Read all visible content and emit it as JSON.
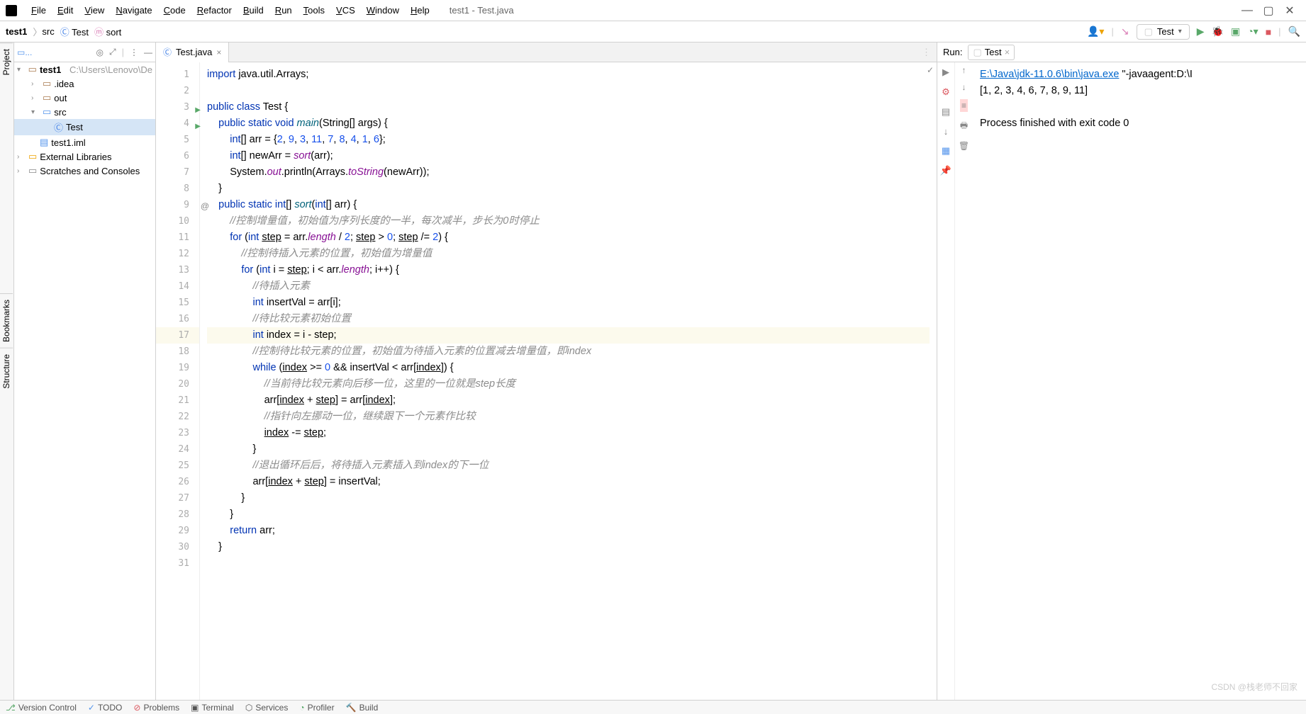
{
  "window": {
    "title": "test1 - Test.java"
  },
  "menu": [
    "File",
    "Edit",
    "View",
    "Navigate",
    "Code",
    "Refactor",
    "Build",
    "Run",
    "Tools",
    "VCS",
    "Window",
    "Help"
  ],
  "breadcrumbs": {
    "project": "test1",
    "src": "src",
    "class": "Test",
    "method": "sort"
  },
  "run_config": "Test",
  "tree": {
    "root": "test1",
    "root_path": "C:\\Users\\Lenovo\\De",
    "idea": ".idea",
    "out": "out",
    "src": "src",
    "test_class": "Test",
    "iml": "test1.iml",
    "ext_lib": "External Libraries",
    "scratches": "Scratches and Consoles"
  },
  "editor_tab": "Test.java",
  "code_lines": [
    {
      "n": 1,
      "html": "<span class='kw'>import</span> java.util.Arrays;"
    },
    {
      "n": 2,
      "html": ""
    },
    {
      "n": 3,
      "html": "<span class='kw'>public class</span> Test {",
      "run": true
    },
    {
      "n": 4,
      "html": "    <span class='kw'>public static void</span> <span class='mth'>main</span>(String[] args) {",
      "run": true
    },
    {
      "n": 5,
      "html": "        <span class='kw'>int</span>[] arr = {<span class='num'>2</span>, <span class='num'>9</span>, <span class='num'>3</span>, <span class='num'>11</span>, <span class='num'>7</span>, <span class='num'>8</span>, <span class='num'>4</span>, <span class='num'>1</span>, <span class='num'>6</span>};"
    },
    {
      "n": 6,
      "html": "        <span class='kw'>int</span>[] newArr = <span class='fld'>sort</span>(arr);"
    },
    {
      "n": 7,
      "html": "        System.<span class='fld'>out</span>.println(Arrays.<span class='fld'>toString</span>(newArr));"
    },
    {
      "n": 8,
      "html": "    }"
    },
    {
      "n": 9,
      "html": "    <span class='kw'>public static int</span>[] <span class='mth'>sort</span>(<span class='kw'>int</span>[] arr) {",
      "at": true
    },
    {
      "n": 10,
      "html": "        <span class='cmt'>//控制增量值，初始值为序列长度的一半，每次减半，步长为0时停止</span>"
    },
    {
      "n": 11,
      "html": "        <span class='kw'>for</span> (<span class='kw'>int</span> <u>step</u> = arr.<span class='fld'>length</span> / <span class='num'>2</span>; <u>step</u> > <span class='num'>0</span>; <u>step</u> /= <span class='num'>2</span>) {"
    },
    {
      "n": 12,
      "html": "            <span class='cmt'>//控制待插入元素的位置，初始值为增量值</span>"
    },
    {
      "n": 13,
      "html": "            <span class='kw'>for</span> (<span class='kw'>int</span> i = <u>step</u>; i &lt; arr.<span class='fld'>length</span>; i++) {"
    },
    {
      "n": 14,
      "html": "                <span class='cmt'>//待插入元素</span>"
    },
    {
      "n": 15,
      "html": "                <span class='kw'>int</span> insertVal = arr[i];"
    },
    {
      "n": 16,
      "html": "                <span class='cmt'>//待比较元素初始位置</span>"
    },
    {
      "n": 17,
      "html": "                <span class='kw'>int</span> index = i - step;",
      "hl": true
    },
    {
      "n": 18,
      "html": "                <span class='cmt'>//控制待比较元素的位置，初始值为待插入元素的位置减去增量值，即index</span>"
    },
    {
      "n": 19,
      "html": "                <span class='kw'>while</span> (<u>index</u> >= <span class='num'>0</span> && insertVal &lt; arr[<u>index</u>]) {"
    },
    {
      "n": 20,
      "html": "                    <span class='cmt'>//当前待比较元素向后移一位，这里的一位就是step长度</span>"
    },
    {
      "n": 21,
      "html": "                    arr[<u>index</u> + <u>step</u>] = arr[<u>index</u>];"
    },
    {
      "n": 22,
      "html": "                    <span class='cmt'>//指针向左挪动一位，继续跟下一个元素作比较</span>"
    },
    {
      "n": 23,
      "html": "                    <u>index</u> -= <u>step</u>;"
    },
    {
      "n": 24,
      "html": "                }"
    },
    {
      "n": 25,
      "html": "                <span class='cmt'>//退出循环后后，将待插入元素插入到index的下一位</span>"
    },
    {
      "n": 26,
      "html": "                arr[<u>index</u> + <u>step</u>] = insertVal;"
    },
    {
      "n": 27,
      "html": "            }"
    },
    {
      "n": 28,
      "html": "        }"
    },
    {
      "n": 29,
      "html": "        <span class='kw'>return</span> arr;"
    },
    {
      "n": 30,
      "html": "    }"
    },
    {
      "n": 31,
      "html": ""
    }
  ],
  "run": {
    "label": "Run:",
    "tab": "Test",
    "cmd_path": "E:\\Java\\jdk-11.0.6\\bin\\java.exe",
    "cmd_args": " \"-javaagent:D:\\I",
    "output_array": "[1, 2, 3, 4, 6, 7, 8, 9, 11]",
    "exit": "Process finished with exit code 0"
  },
  "bottom": [
    "Version Control",
    "TODO",
    "Problems",
    "Terminal",
    "Services",
    "Profiler",
    "Build"
  ],
  "left_tabs": [
    "Project",
    "Bookmarks",
    "Structure"
  ],
  "watermark": "CSDN @栈老师不回家"
}
